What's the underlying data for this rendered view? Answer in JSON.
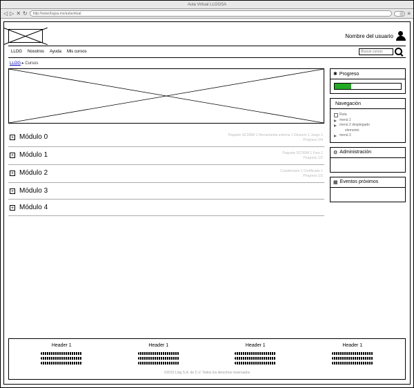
{
  "window_title": "Aula Virtual LLOGSA",
  "url": "http://www.llogsa.mx/aulavirtual",
  "user_name": "Nombre del usuario",
  "nav": [
    "LLOG",
    "Nosotros",
    "Ayuda",
    "Mis cursos"
  ],
  "search_placeholder": "Buscar cursos",
  "breadcrumb_home": "LLOG",
  "breadcrumb_current": "Cursos",
  "modules": [
    {
      "title": "Módulo 0",
      "meta1": "Paquete SCORM 1  Herramienta externa 1  Glosario 1  Juego 1",
      "meta2": "Progreso 0/4"
    },
    {
      "title": "Módulo 1",
      "meta1": "Paquete SCORM 1  Foro 1",
      "meta2": "Progreso 1/2"
    },
    {
      "title": "Módulo 2",
      "meta1": "Cuestionario 1  Certificado 1",
      "meta2": "Progreso 1/2"
    },
    {
      "title": "Módulo 3",
      "meta1": "",
      "meta2": ""
    },
    {
      "title": "Módulo 4",
      "meta1": "",
      "meta2": ""
    }
  ],
  "widgets": {
    "progreso": {
      "title": "Progreso",
      "percent": 25
    },
    "navegacion": {
      "title": "Navegación",
      "items": [
        "Ruta",
        "menú 1",
        "menú 2 desplegado",
        "elemento",
        "menú 3"
      ]
    },
    "administracion": {
      "title": "Administración"
    },
    "eventos": {
      "title": "Eventos próximos"
    }
  },
  "footer_headers": [
    "Header 1",
    "Header 1",
    "Header 1",
    "Header 1"
  ],
  "copyright": "©2015 Llog S.A. de C.V. Todos los derechos reservados"
}
